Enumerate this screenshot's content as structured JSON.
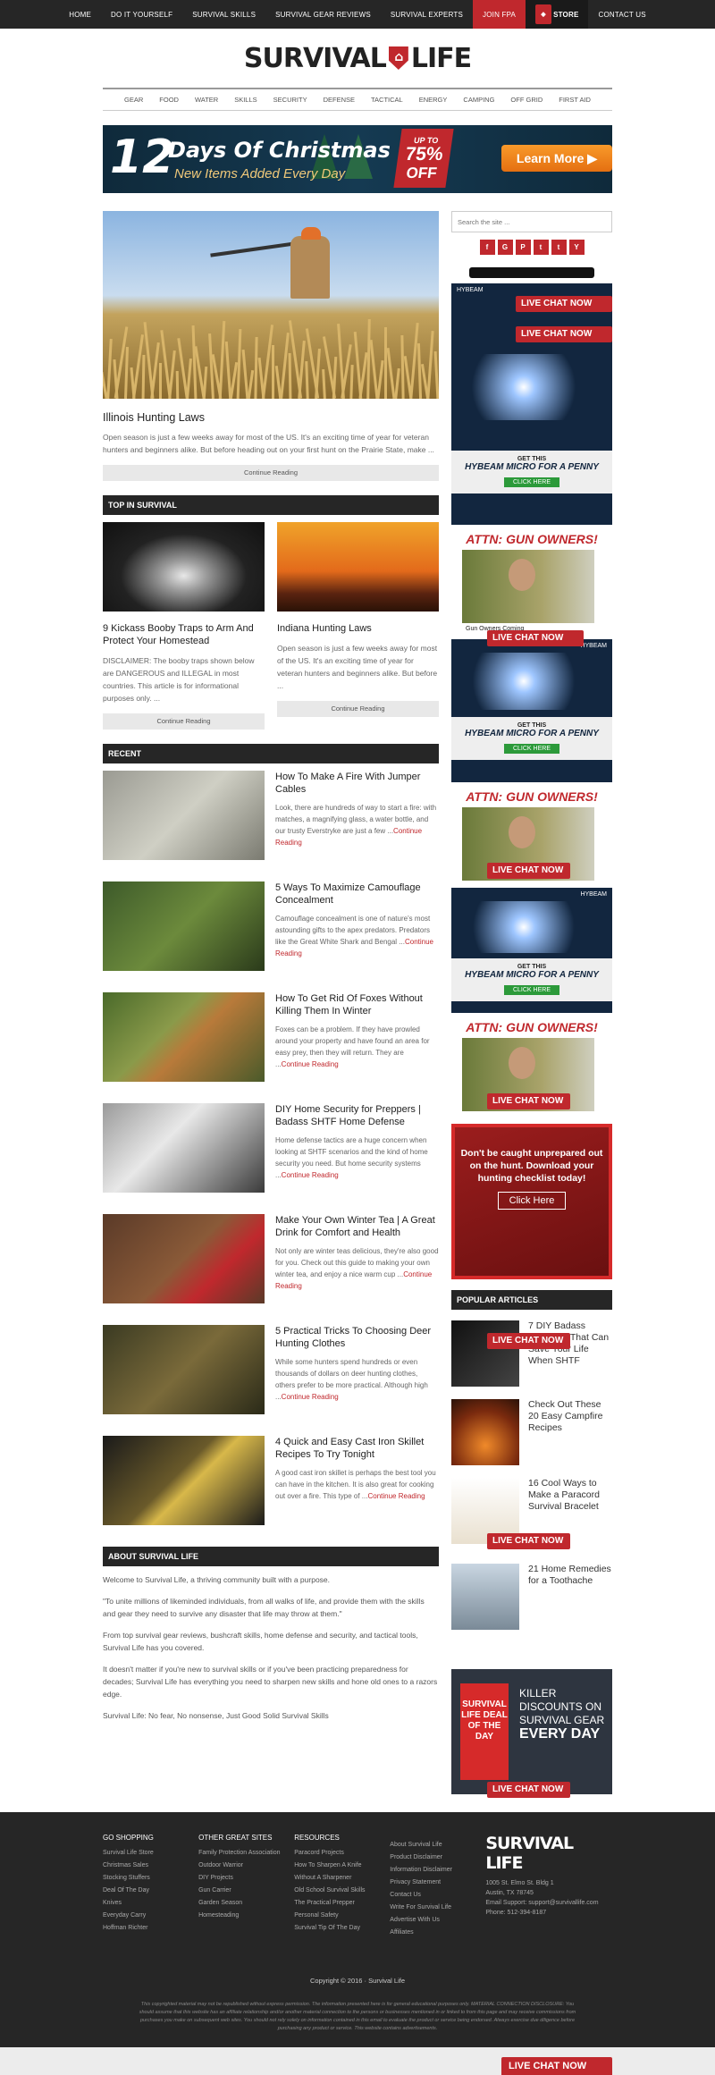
{
  "topnav": [
    "HOME",
    "DO IT YOURSELF",
    "SURVIVAL SKILLS",
    "SURVIVAL GEAR REVIEWS",
    "SURVIVAL EXPERTS",
    "JOIN FPA",
    "STORE",
    "CONTACT US"
  ],
  "logo": {
    "left": "SURVIVAL",
    "right": "LIFE"
  },
  "catnav": [
    "GEAR",
    "FOOD",
    "WATER",
    "SKILLS",
    "SECURITY",
    "DEFENSE",
    "TACTICAL",
    "ENERGY",
    "CAMPING",
    "OFF GRID",
    "FIRST AID"
  ],
  "banner": {
    "num": "12",
    "days": "Days Of Christmas",
    "sub": "New Items Added Every Day",
    "up": "UP TO",
    "pct": "75%",
    "off": "OFF",
    "cta": "Learn More"
  },
  "hero": {
    "title": "Illinois Hunting Laws",
    "excerpt": "Open season is just a few weeks away for most of the US. It's an exciting time of year for veteran hunters and beginners alike. But before heading out on your first hunt on the Prairie State, make ...",
    "cta": "Continue Reading"
  },
  "top_head": "TOP IN SURVIVAL",
  "top": [
    {
      "title": "9 Kickass Booby Traps to Arm And Protect Your Homestead",
      "excerpt": "DISCLAIMER:  The booby traps shown below are DANGEROUS and ILLEGAL in most countries.  This article is for informational purposes only. ...",
      "cta": "Continue Reading"
    },
    {
      "title": "Indiana Hunting Laws",
      "excerpt": "Open season is just a few weeks away for most of the US. It's an exciting time of year for veteran hunters and beginners alike. But before ...",
      "cta": "Continue Reading"
    }
  ],
  "recent_head": "RECENT",
  "recent": [
    {
      "title": "How To Make A Fire With Jumper Cables",
      "excerpt": "Look, there are hundreds of way to start a fire: with matches, a magnifying glass, a water bottle, and our trusty Everstryke are just a few ...",
      "more": "Continue Reading"
    },
    {
      "title": "5 Ways To Maximize Camouflage Concealment",
      "excerpt": "Camouflage concealment is one of nature's most astounding gifts to the apex predators. Predators like the Great White Shark and Bengal ...",
      "more": "Continue Reading"
    },
    {
      "title": "How To Get Rid Of Foxes Without Killing Them In Winter",
      "excerpt": "Foxes can be a problem. If they have prowled around your property and have found an area for easy prey, then they will return. They are ...",
      "more": "Continue Reading"
    },
    {
      "title": "DIY Home Security for Preppers | Badass SHTF Home Defense",
      "excerpt": "Home defense tactics are a huge concern when looking at  SHTF scenarios and the kind of home security you need.  But home security systems ...",
      "more": "Continue Reading"
    },
    {
      "title": "Make Your Own Winter Tea | A Great Drink for Comfort and Health",
      "excerpt": "Not only are winter teas delicious, they're also good for you. Check out this guide to making your own winter tea, and enjoy a nice warm cup ...",
      "more": "Continue Reading"
    },
    {
      "title": "5 Practical Tricks To Choosing Deer Hunting Clothes",
      "excerpt": "While some hunters spend hundreds or even thousands of dollars on deer hunting clothes, others prefer to be more practical. Although high ...",
      "more": "Continue Reading"
    },
    {
      "title": "4 Quick and Easy Cast Iron Skillet Recipes To Try Tonight",
      "excerpt": "A good cast iron skillet is perhaps the best tool you can have in the kitchen. It is also great for cooking out over a fire. This type of ...",
      "more": "Continue Reading"
    }
  ],
  "about_head": "ABOUT SURVIVAL LIFE",
  "about": [
    "Welcome to Survival Life, a thriving community built with a purpose.",
    "\"To unite millions of likeminded individuals, from all walks of life, and provide them with the skills and gear they need to survive any disaster that life may throw at them.\"",
    "From top survival gear reviews, bushcraft skills, home defense and security, and tactical tools, Survival Life has you covered.",
    "It doesn't matter if you're new to survival skills or if you've been practicing preparedness for decades; Survival Life has everything you need to sharpen new skills and hone old ones to a razors edge.",
    "Survival Life: No fear, No nonsense, Just Good Solid Survival Skills"
  ],
  "sidebar": {
    "search_placeholder": "Search the site ...",
    "social": [
      "f",
      "G",
      "P",
      "t",
      "t",
      "Y"
    ],
    "live_chat": "LIVE CHAT NOW",
    "hybeam": "HYBEAM",
    "penny_top": "GET THIS",
    "penny_head": "HYBEAM MICRO FOR A PENNY",
    "penny_click": "CLICK HERE",
    "gun_title": "ATTN: GUN OWNERS!",
    "gun_caption": "Gun Owners Coming",
    "dl_msg": "Don't be caught unprepared out on the hunt. Download your hunting checklist today!",
    "dl_click": "Click Here",
    "popular_head": "POPULAR ARTICLES",
    "popular": [
      "7 DIY Badass Weapons That Can Save Your Life When SHTF",
      "Check Out These 20 Easy Campfire Recipes",
      "16 Cool Ways to Make a Paracord Survival Bracelet",
      "21 Home Remedies for a Toothache"
    ],
    "deal_badge": "SURVIVAL LIFE DEAL OF THE DAY",
    "deal_text1": "KILLER DISCOUNTS ON",
    "deal_text2": "SURVIVAL GEAR",
    "deal_text3": "EVERY DAY"
  },
  "footer": {
    "cols": [
      {
        "head": "GO SHOPPING",
        "links": [
          "Survival Life Store",
          "Christmas Sales",
          "Stocking Stuffers",
          "Deal Of The Day",
          "Knives",
          "Everyday Carry",
          "Hoffman Richter"
        ]
      },
      {
        "head": "OTHER GREAT SITES",
        "links": [
          "Family Protection Association",
          "Outdoor Warrior",
          "DIY Projects",
          "Gun Carrier",
          "Garden Season",
          "Homesteading"
        ]
      },
      {
        "head": "RESOURCES",
        "links": [
          "Paracord Projects",
          "How To Sharpen A Knife Without A Sharpener",
          "Old School Survival Skills",
          "The Practical Prepper",
          "Personal Safety",
          "Survival Tip Of The Day"
        ]
      },
      {
        "head": "",
        "links": [
          "About Survival Life",
          "Product Disclaimer",
          "Information Disclaimer",
          "Privacy Statement",
          "Contact Us",
          "Write For Survival Life",
          "Advertise With Us",
          "Affiliates"
        ]
      }
    ],
    "logo": "SURVIVAL LIFE",
    "address": [
      "1005 St. Elmo St. Bldg 1",
      "Austin, TX 78745",
      "Email Support: support@survivallife.com",
      "Phone: 512-394-8187"
    ],
    "copyright": "Copyright © 2016 · Survival Life",
    "disclaimer": "This copyrighted material may not be republished without express permission. The information presented here is for general educational purposes only. MATERIAL CONNECTION DISCLOSURE: You should assume that this website has an affiliate relationship and/or another material connection to the persons or businesses mentioned in or linked to from this page and may receive commissions from purchases you make on subsequent web sites. You should not rely solely on information contained in this email to evaluate the product or service being endorsed. Always exercise due diligence before purchasing any product or service. This website contains advertisements."
  }
}
